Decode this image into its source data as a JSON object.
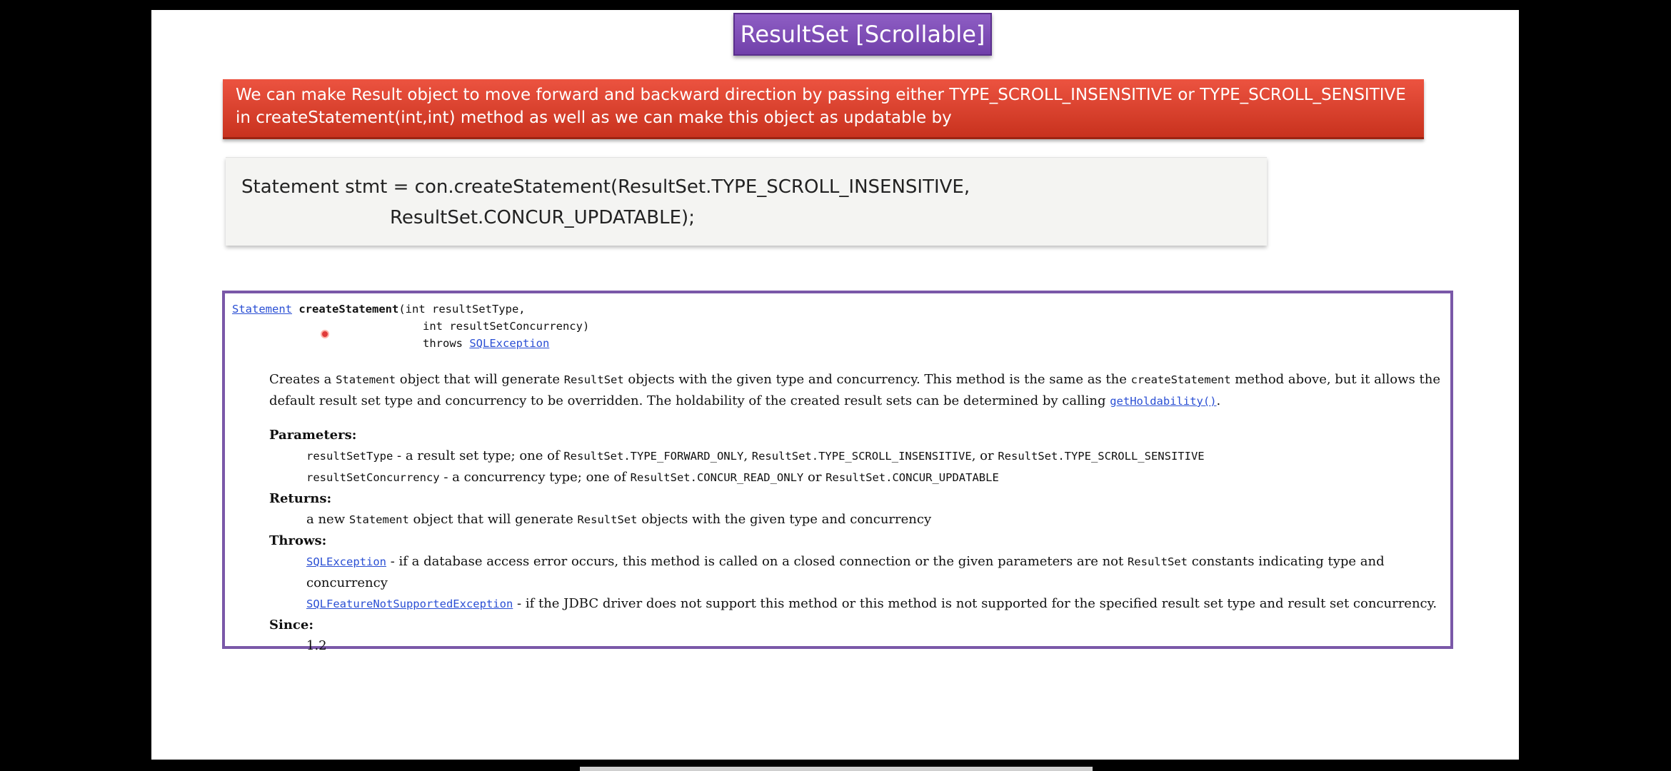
{
  "slide": {
    "title": "ResultSet [Scrollable]",
    "banner_text": "We can make Result object to move forward and backward direction by passing either TYPE_SCROLL_INSENSITIVE or TYPE_SCROLL_SENSITIVE in createStatement(int,int) method as well as we can make this object as updatable by",
    "code_lines": [
      "Statement stmt = con.createStatement(ResultSet.TYPE_SCROLL_INSENSITIVE,",
      "ResultSet.CONCUR_UPDATABLE);"
    ]
  },
  "doc": {
    "signature": {
      "return_type": "Statement",
      "method": "createStatement",
      "param1": "(int resultSetType,",
      "param2": "int resultSetConcurrency)",
      "throws_kw": "throws ",
      "throws_link": "SQLException"
    },
    "description": {
      "p1": "Creates a ",
      "c1": "Statement",
      "p2": " object that will generate ",
      "c2": "ResultSet",
      "p3": " objects with the given type and concurrency. This method is the same as the ",
      "c3": "createStatement",
      "p4": " method above, but it allows the default result set type and concurrency to be overridden. The holdability of the created result sets can be determined by calling ",
      "link": "getHoldability()",
      "p5": "."
    },
    "parameters": {
      "heading": "Parameters:",
      "type_name": "resultSetType",
      "type_text1": " - a result set type; one of ",
      "type_c1": "ResultSet.TYPE_FORWARD_ONLY",
      "type_sep1": ", ",
      "type_c2": "ResultSet.TYPE_SCROLL_INSENSITIVE",
      "type_sep2": ", or ",
      "type_c3": "ResultSet.TYPE_SCROLL_SENSITIVE",
      "conc_name": "resultSetConcurrency",
      "conc_text1": " - a concurrency type; one of ",
      "conc_c1": "ResultSet.CONCUR_READ_ONLY",
      "conc_sep": " or ",
      "conc_c2": "ResultSet.CONCUR_UPDATABLE"
    },
    "returns": {
      "heading": "Returns:",
      "t1": "a new ",
      "c1": "Statement",
      "t2": " object that will generate ",
      "c2": "ResultSet",
      "t3": " objects with the given type and concurrency"
    },
    "throws": {
      "heading": "Throws:",
      "ex1_link": "SQLException",
      "ex1_text1": " - if a database access error occurs, this method is called on a closed connection or the given parameters are not ",
      "ex1_code": "ResultSet",
      "ex1_text2": " constants indicating type and concurrency",
      "ex2_link": "SQLFeatureNotSupportedException",
      "ex2_text": " - if the JDBC driver does not support this method or this method is not supported for the specified result set type and result set concurrency."
    },
    "since": {
      "heading": "Since:",
      "value": "1.2"
    }
  },
  "colors": {
    "title_bg": "#7f4fb8",
    "banner_bg": "#d9402b",
    "doc_border": "#7a58a8",
    "link": "#2a4fd4"
  }
}
